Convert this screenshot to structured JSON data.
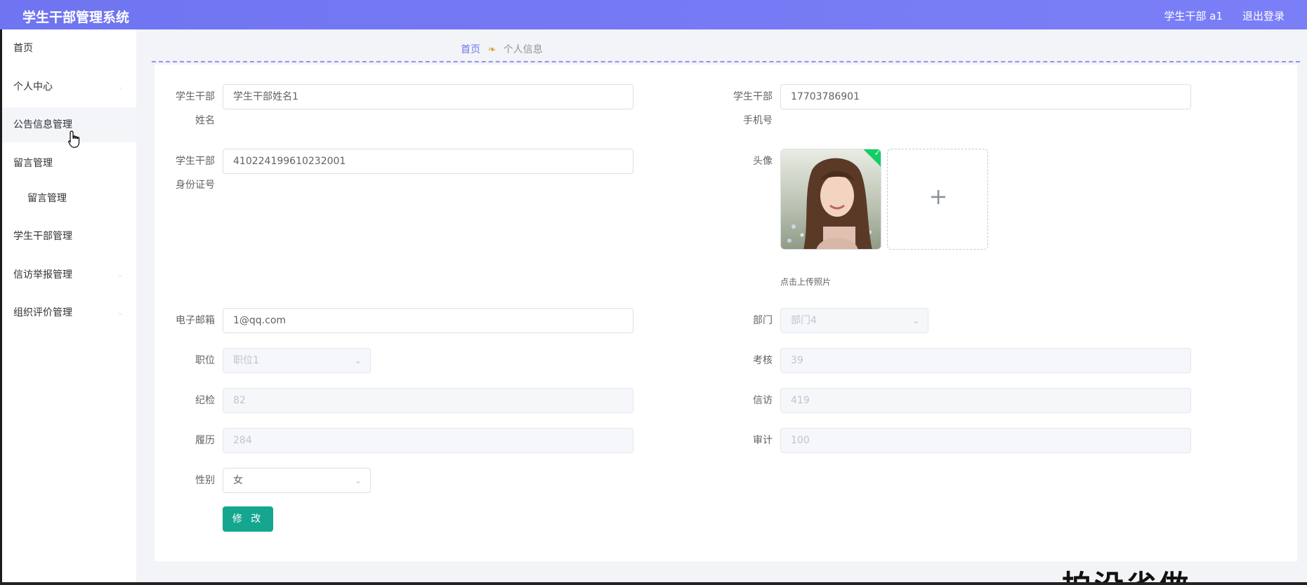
{
  "header": {
    "title": "学生干部管理系统",
    "user": "学生干部 a1",
    "logout": "退出登录"
  },
  "sidebar": {
    "items": [
      {
        "label": "首页"
      },
      {
        "label": "个人中心"
      },
      {
        "label": "公告信息管理"
      },
      {
        "label": "留言管理"
      },
      {
        "label": "留言管理"
      },
      {
        "label": "学生干部管理"
      },
      {
        "label": "信访举报管理"
      },
      {
        "label": "组织评价管理"
      }
    ]
  },
  "breadcrumb": {
    "home": "首页",
    "current": "个人信息"
  },
  "form": {
    "name": {
      "label1": "学生干部",
      "label2": "姓名",
      "value": "学生干部姓名1"
    },
    "phone": {
      "label1": "学生干部",
      "label2": "手机号",
      "value": "17703786901"
    },
    "idcard": {
      "label1": "学生干部",
      "label2": "身份证号",
      "value": "410224199610232001"
    },
    "avatar": {
      "label": "头像",
      "hint": "点击上传照片"
    },
    "email": {
      "label": "电子邮箱",
      "value": "1@qq.com"
    },
    "department": {
      "label": "部门",
      "value": "部门4"
    },
    "position": {
      "label": "职位",
      "value": "职位1"
    },
    "assessment": {
      "label": "考核",
      "value": "39"
    },
    "discipline": {
      "label": "纪检",
      "value": "82"
    },
    "petition": {
      "label": "信访",
      "value": "419"
    },
    "resume": {
      "label": "履历",
      "value": "284"
    },
    "audit": {
      "label": "审计",
      "value": "100"
    },
    "gender": {
      "label": "性别",
      "value": "女"
    },
    "submit": "修 改"
  },
  "overlay_text": "拍没省做"
}
